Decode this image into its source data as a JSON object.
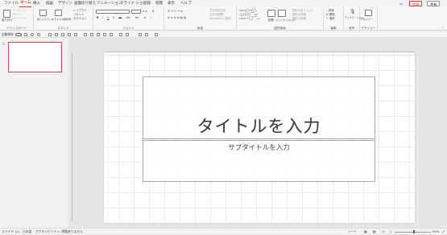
{
  "menu": {
    "tabs": [
      "ファイル",
      "ホーム",
      "挿入",
      "描画",
      "デザイン",
      "画面切り替え",
      "アニメーション",
      "スライド ショー",
      "記録",
      "校閲",
      "表示",
      "ヘルプ"
    ],
    "active": "ホーム",
    "comment_label": "コメント",
    "share_label": "共有",
    "record_label": "記録"
  },
  "ribbon": {
    "groups": [
      "クリップボード",
      "スライド",
      "フォント",
      "段落",
      "図形描画",
      "編集",
      "音声",
      "デザイナー"
    ],
    "paste_label": "貼り付け",
    "new_slide_label": "新しいスライド",
    "reuse_label": "スライドの再利用",
    "layout_label": "レイアウト",
    "reset_label": "リセット",
    "section_label": "セクション",
    "text_direction_label": "文字列の方向",
    "align_text_label": "文字の配置",
    "smartart_label": "SmartArt に変換",
    "arrange_label": "配置",
    "quick_styles_label": "クイック スタイル",
    "shape_fill_label": "図形の塗りつぶし",
    "shape_outline_label": "図形の枠線",
    "shape_effects_label": "図形の効果",
    "find_label": "検索",
    "replace_label": "置換",
    "select_label": "選択",
    "dictate_label": "ディクテーション",
    "designer_label": "デザイナー"
  },
  "quick_access": {
    "autosave_label": "自動保存"
  },
  "thumbnails": [
    {
      "num": "1"
    }
  ],
  "slide": {
    "title_placeholder": "タイトルを入力",
    "subtitle_placeholder": "サブタイトルを入力"
  },
  "status": {
    "slide_count": "スライド 1/1",
    "language": "日本語",
    "accessibility": "アクセシビリティ: 問題ありません",
    "notes": "ノート",
    "zoom": "99%"
  },
  "colors": {
    "accent": "#b7472a",
    "slide_border": "#c0504d"
  }
}
